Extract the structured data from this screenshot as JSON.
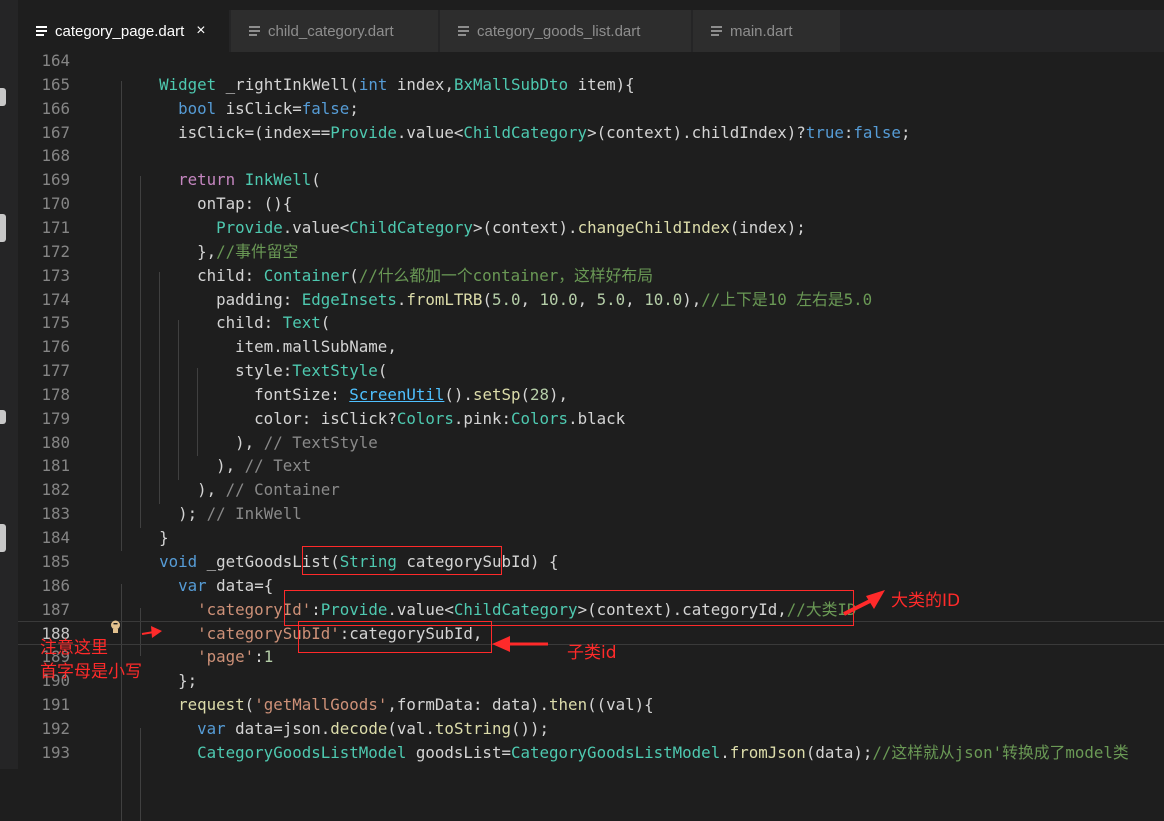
{
  "tabs": [
    {
      "label": "category_page.dart",
      "active": true,
      "close": "×"
    },
    {
      "label": "child_category.dart",
      "active": false
    },
    {
      "label": "category_goods_list.dart",
      "active": false
    },
    {
      "label": "main.dart",
      "active": false
    }
  ],
  "colors": {
    "keyword": "#569cd6",
    "type": "#4ec9b0",
    "function": "#dcdcaa",
    "string": "#ce9178",
    "number": "#b5cea8",
    "comment": "#6a9955",
    "annotation": "#ff2a2a"
  },
  "lines": [
    {
      "n": "164",
      "t": []
    },
    {
      "n": "165",
      "t": [
        [
          "      ",
          ""
        ],
        [
          "Widget",
          "ty"
        ],
        [
          " _rightInkWell(",
          ""
        ],
        [
          "int",
          "kw"
        ],
        [
          " index,",
          ""
        ],
        [
          "BxMallSubDto",
          "ty"
        ],
        [
          " item){",
          ""
        ]
      ]
    },
    {
      "n": "166",
      "t": [
        [
          "        ",
          ""
        ],
        [
          "bool",
          "kw"
        ],
        [
          " isClick=",
          ""
        ],
        [
          "false",
          "kw"
        ],
        [
          ";",
          ""
        ]
      ]
    },
    {
      "n": "167",
      "t": [
        [
          "        isClick=(index==",
          ""
        ],
        [
          "Provide",
          "ty"
        ],
        [
          ".value<",
          ""
        ],
        [
          "ChildCategory",
          "ty"
        ],
        [
          ">(context).childIndex)?",
          ""
        ],
        [
          "true",
          "kw"
        ],
        [
          ":",
          ""
        ],
        [
          "false",
          "kw"
        ],
        [
          ";",
          ""
        ]
      ]
    },
    {
      "n": "168",
      "t": []
    },
    {
      "n": "169",
      "t": [
        [
          "        ",
          ""
        ],
        [
          "return",
          "ctl"
        ],
        [
          " ",
          ""
        ],
        [
          "InkWell",
          "ty"
        ],
        [
          "(",
          ""
        ]
      ]
    },
    {
      "n": "170",
      "t": [
        [
          "          onTap: (){",
          ""
        ]
      ]
    },
    {
      "n": "171",
      "t": [
        [
          "            ",
          ""
        ],
        [
          "Provide",
          "ty"
        ],
        [
          ".value<",
          ""
        ],
        [
          "ChildCategory",
          "ty"
        ],
        [
          ">(context).",
          ""
        ],
        [
          "changeChildIndex",
          "fn"
        ],
        [
          "(index);",
          ""
        ]
      ]
    },
    {
      "n": "172",
      "t": [
        [
          "          },",
          ""
        ],
        [
          "//事件留空",
          "cm"
        ]
      ]
    },
    {
      "n": "173",
      "t": [
        [
          "          child: ",
          ""
        ],
        [
          "Container",
          "ty"
        ],
        [
          "(",
          ""
        ],
        [
          "//什么都加一个container，这样好布局",
          "cm"
        ]
      ]
    },
    {
      "n": "174",
      "t": [
        [
          "            padding: ",
          ""
        ],
        [
          "EdgeInsets",
          "ty"
        ],
        [
          ".",
          ""
        ],
        [
          "fromLTRB",
          "fn"
        ],
        [
          "(",
          ""
        ],
        [
          "5.0",
          "num"
        ],
        [
          ", ",
          ""
        ],
        [
          "10.0",
          "num"
        ],
        [
          ", ",
          ""
        ],
        [
          "5.0",
          "num"
        ],
        [
          ", ",
          ""
        ],
        [
          "10.0",
          "num"
        ],
        [
          "),",
          ""
        ],
        [
          "//上下是10 左右是5.0",
          "cm"
        ]
      ]
    },
    {
      "n": "175",
      "t": [
        [
          "            child: ",
          ""
        ],
        [
          "Text",
          "ty"
        ],
        [
          "(",
          ""
        ]
      ]
    },
    {
      "n": "176",
      "t": [
        [
          "              item.mallSubName,",
          ""
        ]
      ]
    },
    {
      "n": "177",
      "t": [
        [
          "              style:",
          ""
        ],
        [
          "TextStyle",
          "ty"
        ],
        [
          "(",
          ""
        ]
      ]
    },
    {
      "n": "178",
      "t": [
        [
          "                fontSize: ",
          ""
        ],
        [
          "ScreenUtil",
          "lnk"
        ],
        [
          "().",
          ""
        ],
        [
          "setSp",
          "fn"
        ],
        [
          "(",
          ""
        ],
        [
          "28",
          "num"
        ],
        [
          "),",
          ""
        ]
      ]
    },
    {
      "n": "179",
      "t": [
        [
          "                color: isClick?",
          ""
        ],
        [
          "Colors",
          "ty"
        ],
        [
          ".pink:",
          ""
        ],
        [
          "Colors",
          "ty"
        ],
        [
          ".black",
          ""
        ]
      ]
    },
    {
      "n": "180",
      "t": [
        [
          "              ), ",
          ""
        ],
        [
          "// TextStyle",
          "cmg"
        ]
      ]
    },
    {
      "n": "181",
      "t": [
        [
          "            ), ",
          ""
        ],
        [
          "// Text",
          "cmg"
        ]
      ]
    },
    {
      "n": "182",
      "t": [
        [
          "          ), ",
          ""
        ],
        [
          "// Container",
          "cmg"
        ]
      ]
    },
    {
      "n": "183",
      "t": [
        [
          "        ); ",
          ""
        ],
        [
          "// InkWell",
          "cmg"
        ]
      ]
    },
    {
      "n": "184",
      "t": [
        [
          "      }",
          ""
        ]
      ]
    },
    {
      "n": "185",
      "t": [
        [
          "      ",
          ""
        ],
        [
          "void",
          "kw"
        ],
        [
          " _getGoodsList(",
          ""
        ],
        [
          "String",
          "ty"
        ],
        [
          " categorySubId) {",
          ""
        ]
      ]
    },
    {
      "n": "186",
      "t": [
        [
          "        ",
          ""
        ],
        [
          "var",
          "kw"
        ],
        [
          " data={",
          ""
        ]
      ]
    },
    {
      "n": "187",
      "t": [
        [
          "          ",
          ""
        ],
        [
          "'categoryId'",
          "str"
        ],
        [
          ":",
          ""
        ],
        [
          "Provide",
          "ty"
        ],
        [
          ".value<",
          ""
        ],
        [
          "ChildCategory",
          "ty"
        ],
        [
          ">(context).categoryId,",
          ""
        ],
        [
          "//大类ID",
          "cm"
        ]
      ]
    },
    {
      "n": "188",
      "t": [
        [
          "          ",
          ""
        ],
        [
          "'categorySubId'",
          "str"
        ],
        [
          ":categorySubId,",
          ""
        ]
      ]
    },
    {
      "n": "189",
      "t": [
        [
          "          ",
          ""
        ],
        [
          "'page'",
          "str"
        ],
        [
          ":",
          ""
        ],
        [
          "1",
          "num"
        ]
      ]
    },
    {
      "n": "190",
      "t": [
        [
          "        };",
          ""
        ]
      ]
    },
    {
      "n": "191",
      "t": [
        [
          "        ",
          ""
        ],
        [
          "request",
          "fn"
        ],
        [
          "(",
          ""
        ],
        [
          "'getMallGoods'",
          "str"
        ],
        [
          ",formData: data).",
          ""
        ],
        [
          "then",
          "fn"
        ],
        [
          "((val){",
          ""
        ]
      ]
    },
    {
      "n": "192",
      "t": [
        [
          "          ",
          ""
        ],
        [
          "var",
          "kw"
        ],
        [
          " data=json.",
          ""
        ],
        [
          "decode",
          "fn"
        ],
        [
          "(val.",
          ""
        ],
        [
          "toString",
          "fn"
        ],
        [
          "());",
          ""
        ]
      ]
    },
    {
      "n": "193",
      "t": [
        [
          "          ",
          ""
        ],
        [
          "CategoryGoodsListModel",
          "ty"
        ],
        [
          " goodsList=",
          ""
        ],
        [
          "CategoryGoodsListModel",
          "ty"
        ],
        [
          ".",
          ""
        ],
        [
          "fromJson",
          "fn"
        ],
        [
          "(data);",
          ""
        ],
        [
          "//这样就从json'转换成了model类",
          "cm"
        ]
      ]
    }
  ],
  "annotations": {
    "big_class_id": "大类的ID",
    "sub_class_id": "子类id",
    "note_line1": "注意这里",
    "note_line2": "首字母是小写"
  }
}
